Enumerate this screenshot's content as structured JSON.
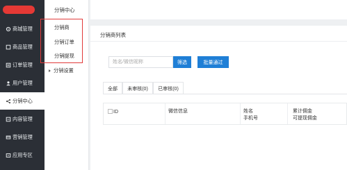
{
  "sidebar": {
    "items": [
      {
        "label": "商城管理",
        "icon": "gear-icon"
      },
      {
        "label": "商品管理",
        "icon": "box-icon"
      },
      {
        "label": "订单管理",
        "icon": "list-icon"
      },
      {
        "label": "用户管理",
        "icon": "user-icon"
      },
      {
        "label": "分销中心",
        "icon": "share-icon"
      },
      {
        "label": "内容管理",
        "icon": "content-icon"
      },
      {
        "label": "营销管理",
        "icon": "marketing-icon"
      },
      {
        "label": "应用专区",
        "icon": "app-icon"
      }
    ]
  },
  "submenu": {
    "title": "分销中心",
    "items": [
      "分销商",
      "分销订单",
      "分销提现"
    ],
    "settings": "分销设置"
  },
  "main": {
    "panel_title": "分销商列表",
    "search_placeholder": "姓名/微信昵称",
    "filter_button": "筛选",
    "approve_button": "批量通过",
    "tabs": [
      "全部",
      "未审核(0)",
      "已审核(0)"
    ],
    "columns": [
      {
        "line1": "ID",
        "line2": ""
      },
      {
        "line1": "微信信息",
        "line2": ""
      },
      {
        "line1": "姓名",
        "line2": "手机号"
      },
      {
        "line1": "累计佣金",
        "line2": "可提现佣金"
      }
    ]
  },
  "colors": {
    "sidebar_bg": "#2b2f36",
    "accent_blue": "#1f7fd6",
    "highlight_red": "#e23a3a"
  }
}
